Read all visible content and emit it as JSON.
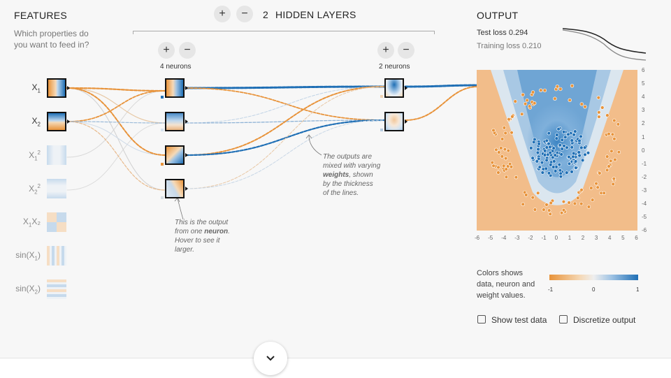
{
  "features": {
    "title": "FEATURES",
    "subtitle_line1": "Which properties do",
    "subtitle_line2": "you want to feed in?",
    "items": [
      {
        "base": "X",
        "sub": "1",
        "sup": "",
        "pre": "",
        "post": "",
        "active": true
      },
      {
        "base": "X",
        "sub": "2",
        "sup": "",
        "pre": "",
        "post": "",
        "active": true
      },
      {
        "base": "X",
        "sub": "1",
        "sup": "2",
        "pre": "",
        "post": "",
        "active": false
      },
      {
        "base": "X",
        "sub": "2",
        "sup": "2",
        "pre": "",
        "post": "",
        "active": false
      },
      {
        "base": "X",
        "sub": "1",
        "sup": "",
        "pre": "",
        "post": "X₂",
        "active": false
      },
      {
        "base": "X",
        "sub": "1",
        "sup": "",
        "pre": "sin(",
        "post": ")",
        "active": false
      },
      {
        "base": "X",
        "sub": "2",
        "sup": "",
        "pre": "sin(",
        "post": ")",
        "active": false
      }
    ]
  },
  "hidden": {
    "count": "2",
    "label": "HIDDEN LAYERS",
    "add_symbol": "+",
    "remove_symbol": "−",
    "layer1_label": "4 neurons",
    "layer2_label": "2 neurons"
  },
  "notes": {
    "neuron_line1": "This is the output",
    "neuron_line2_pre": "from one ",
    "neuron_line2_bold": "neuron",
    "neuron_line2_post": ".",
    "neuron_line3": "Hover to see it",
    "neuron_line4": "larger.",
    "weights_line1": "The outputs are",
    "weights_line2": "mixed with varying",
    "weights_line3_bold": "weights",
    "weights_line3_post": ", shown",
    "weights_line4": "by the thickness",
    "weights_line5": "of the lines."
  },
  "output": {
    "title": "OUTPUT",
    "test_loss_label": "Test loss",
    "test_loss_value": "0.294",
    "training_loss_label": "Training loss",
    "training_loss_value": "0.210",
    "axis_ticks": [
      "-6",
      "-5",
      "-4",
      "-3",
      "-2",
      "-1",
      "0",
      "1",
      "2",
      "3",
      "4",
      "5",
      "6"
    ],
    "y_ticks": [
      "6",
      "5",
      "4",
      "3",
      "2",
      "1",
      "0",
      "-1",
      "-2",
      "-3",
      "-4",
      "-5",
      "-6"
    ],
    "legend_line1": "Colors shows",
    "legend_line2": "data, neuron and",
    "legend_line3": "weight values.",
    "scale_min": "-1",
    "scale_mid": "0",
    "scale_max": "1",
    "show_test_label": "Show test data",
    "discretize_label": "Discretize output"
  },
  "colors": {
    "blue": "#1f6fb5",
    "orange": "#e8933a",
    "background": "#f7f7f7"
  },
  "icons": {
    "scroll_down": "chevron-down-icon"
  }
}
